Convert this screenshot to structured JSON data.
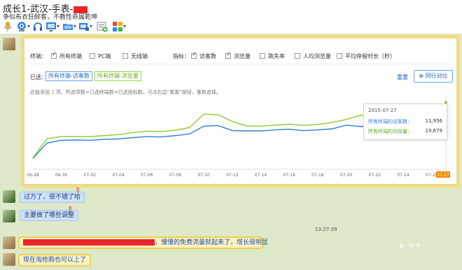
{
  "window": {
    "title": "成长1-武汉-手表-",
    "motto": "争似布衣狂醉客，不教性命属乾坤"
  },
  "toolbar": {
    "icons": [
      "microphone-icon",
      "video-camera-icon",
      "headset-icon",
      "screen-share-icon",
      "folder-icon",
      "remote-desktop-icon",
      "add-app-icon",
      "apps-grid-icon"
    ]
  },
  "filters": {
    "terminal_label": "终端：",
    "terminals": [
      {
        "label": "所有终端",
        "checked": true
      },
      {
        "label": "PC端",
        "checked": false
      },
      {
        "label": "无线端",
        "checked": false
      }
    ],
    "metric_label": "指标：",
    "metrics": [
      {
        "label": "访客数",
        "checked": true
      },
      {
        "label": "浏览量",
        "checked": true
      },
      {
        "label": "跳失率",
        "checked": false
      },
      {
        "label": "人均浏览量",
        "checked": false
      },
      {
        "label": "平均停留时长（秒）",
        "checked": false
      }
    ],
    "selected_label": "已选：",
    "selected_chips": [
      "所有终端-访客数",
      "所有终端-浏览量"
    ],
    "reset_label": "重置",
    "compare_label": "同行对比",
    "hint_pre": "还能添加",
    "hint_count": "2",
    "hint_post": "项，所选项数=已选终端数×已选指标数，可点右边“重置”按钮，重新选择。",
    "accent_blue": "#1a66c8",
    "accent_orange": "#f08a00"
  },
  "chart_data": {
    "type": "line",
    "x": [
      "06-28",
      "06-29",
      "06-30",
      "07-01",
      "07-02",
      "07-03",
      "07-04",
      "07-05",
      "07-06",
      "07-07",
      "07-08",
      "07-09",
      "07-10",
      "07-11",
      "07-12",
      "07-13",
      "07-14",
      "07-15",
      "07-16",
      "07-17",
      "07-18",
      "07-19",
      "07-20",
      "07-21",
      "07-22",
      "07-23",
      "07-24",
      "07-25",
      "07-26",
      "07-27"
    ],
    "tick_labels": [
      "06-28",
      "06-30",
      "07-02",
      "07-04",
      "07-06",
      "07-08",
      "07-10",
      "07-12",
      "07-14",
      "07-16",
      "07-18",
      "07-20",
      "07-22",
      "07-24",
      "07-26",
      "07-27"
    ],
    "series": [
      {
        "name": "所有终端的访客数",
        "color": "#2f7ed8",
        "values": [
          3000,
          7600,
          8400,
          8500,
          8400,
          8700,
          8800,
          9200,
          9500,
          9400,
          9800,
          10300,
          12600,
          12800,
          11300,
          11200,
          11200,
          11500,
          11700,
          11300,
          11500,
          11800,
          12900,
          12500,
          12600,
          12700,
          12100,
          12300,
          12400,
          11956
        ]
      },
      {
        "name": "所有终端的浏览量",
        "color": "#8fcc2c",
        "values": [
          3200,
          8900,
          9500,
          9500,
          9500,
          9800,
          10100,
          10700,
          11100,
          11000,
          11400,
          12200,
          16200,
          16000,
          14000,
          12700,
          12600,
          12900,
          13200,
          12800,
          13100,
          13700,
          14600,
          15900,
          14700,
          14600,
          14300,
          14800,
          15100,
          19679
        ]
      }
    ],
    "ylim": [
      0,
      21000
    ],
    "grid": false
  },
  "tooltip": {
    "date": "2015-07-27",
    "rows": [
      {
        "label": "所有终端的访客数：",
        "value": "11,956",
        "color": "#2f7ed8"
      },
      {
        "label": "所有终端的浏览量：",
        "value": "19,679",
        "color": "#6aa815"
      }
    ]
  },
  "messages": [
    {
      "sender": "other",
      "text": "过万了，很不错了哈"
    },
    {
      "sender": "other",
      "text": "主要做了哪些调整"
    },
    {
      "sender": "me",
      "text": "，慢慢的免费流量就起来了，增长很明显"
    },
    {
      "sender": "me",
      "text": "现在淘抢购也可以上了"
    }
  ],
  "timestamp": "13:27:39"
}
